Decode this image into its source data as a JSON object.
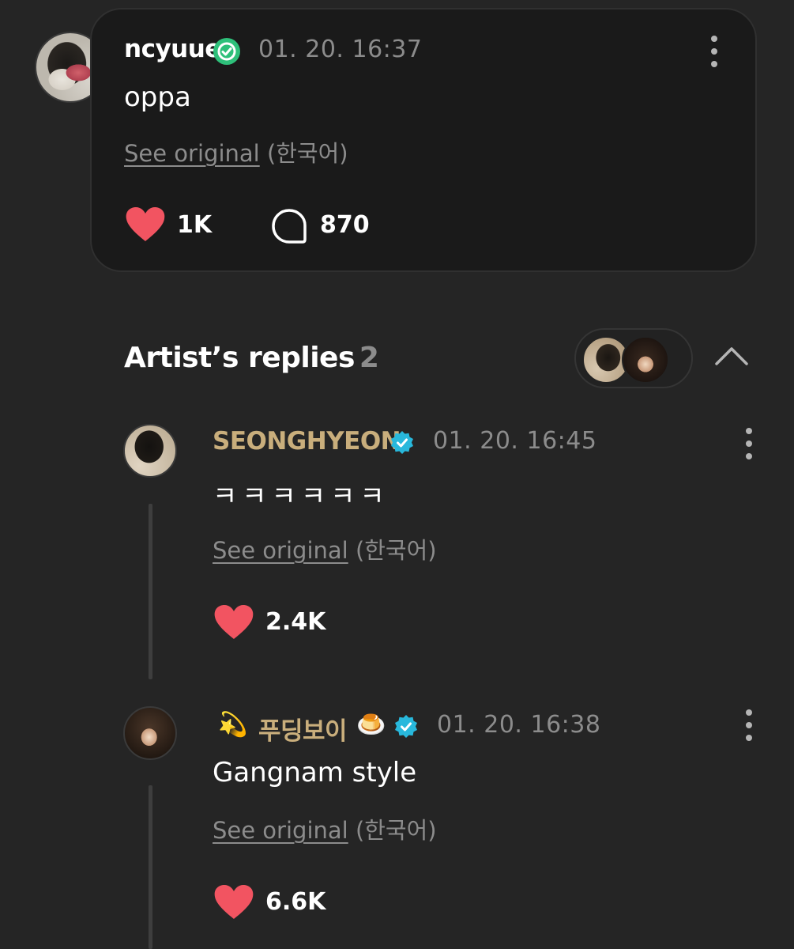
{
  "post": {
    "username": "ncyuue",
    "timestamp": "01. 20. 16:37",
    "text": "oppa",
    "see_original": "See original",
    "language": "(한국어)",
    "likes": "1K",
    "comments": "870"
  },
  "artist_replies": {
    "title": "Artist’s replies",
    "count": "2",
    "replies": [
      {
        "username": "SEONGHYEON",
        "timestamp": "01. 20. 16:45",
        "text": "ㅋㅋㅋㅋㅋㅋ",
        "see_original": "See original",
        "language": "(한국어)",
        "likes": "2.4K"
      },
      {
        "username_prefix_emoji": "💫",
        "username": "푸딩보이",
        "username_suffix_emoji": "🍮",
        "timestamp": "01. 20. 16:38",
        "text": "Gangnam style",
        "see_original": "See original",
        "language": "(한국어)",
        "likes": "6.6K"
      }
    ]
  },
  "colors": {
    "background": "#252525",
    "card": "#1a1a1a",
    "heart": "#f25461",
    "fan_verified": "#2ec07a",
    "artist_verified": "#28b8dc",
    "artist_name": "#c9ae7c",
    "secondary_text": "#8c8c8c"
  },
  "icons": [
    "verified-badge-icon",
    "more-vertical-icon",
    "heart-icon",
    "comment-bubble-icon",
    "chevron-up-icon"
  ]
}
